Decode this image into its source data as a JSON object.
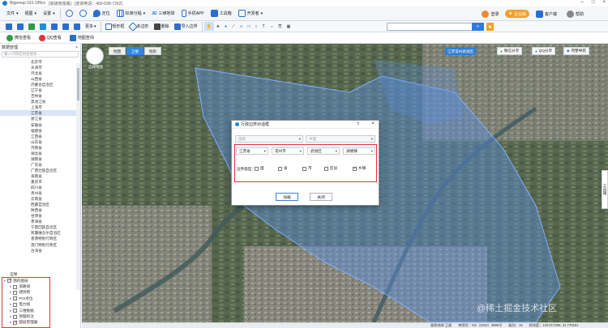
{
  "titlebar": {
    "app": "Bigemap GIS Office",
    "edition": "[高级增强版]",
    "hotline": "[咨询电话：400-028-7262]"
  },
  "menu": {
    "file": "文件",
    "view": "视图",
    "settings": "设置",
    "location": "定位",
    "tile": "标准分幅",
    "three_d": "三维地球",
    "app3d": "3D",
    "phone": "手机APP",
    "toolbox": "工具箱",
    "dev": "开发者",
    "login": "登录",
    "enterprise": "企业版",
    "service": "客户端",
    "help": "帮助"
  },
  "toolbar": {
    "more": "更多",
    "grid": "矩形框",
    "polygon": "多边形",
    "delete": "删除",
    "import": "导入边界",
    "search_placeholder": "",
    "search_icon": "search-icon"
  },
  "bookmarks": {
    "wechat": "微信查看",
    "qq": "QQ查看",
    "map_service": "地图查询"
  },
  "sidebar": {
    "title": "数据管理",
    "search_placeholder": "输入行政区划名搜索...",
    "provinces": [
      "北京市",
      "天津市",
      "河北省",
      "山西省",
      "内蒙古自治区",
      "辽宁省",
      "吉林省",
      "黑龙江省",
      "上海市",
      "江苏省",
      "浙江省",
      "安徽省",
      "福建省",
      "江西省",
      "山东省",
      "河南省",
      "湖北省",
      "湖南省",
      "广东省",
      "广西壮族自治区",
      "海南省",
      "重庆市",
      "四川省",
      "贵州省",
      "云南省",
      "西藏自治区",
      "陕西省",
      "甘肃省",
      "青海省",
      "宁夏回族自治区",
      "新疆维吾尔自治区",
      "香港特别行政区",
      "澳门特别行政区",
      "台湾省"
    ],
    "selected_index": 9,
    "global_label": "全球",
    "layers": [
      {
        "label": "我的图层",
        "checked": true
      },
      {
        "label": "道路线",
        "checked": false
      },
      {
        "label": "建筑物",
        "checked": false
      },
      {
        "label": "POI点位",
        "checked": false
      },
      {
        "label": "电力线",
        "checked": false
      },
      {
        "label": "三维数据",
        "checked": false
      },
      {
        "label": "地理标注",
        "checked": false
      },
      {
        "label": "图层管理器",
        "checked": true
      }
    ]
  },
  "map": {
    "logo_label": "选择地图",
    "tabs": [
      "地图",
      "卫星",
      "地形"
    ],
    "active_tab": 1,
    "admin_chip": "江苏常州武进区",
    "right_buttons": [
      "微信分享",
      "QQ分享",
      "完整导航"
    ],
    "side_tool": "工具箱",
    "watermark": "@稀土掘金技术社区"
  },
  "status": {
    "source": "星图地球 卫星",
    "review": "审图号：GS（2022）3995号",
    "level": "级别：15",
    "coords": "经纬度：120.017296, 31.778151"
  },
  "dialog": {
    "title": "行政边界对话框",
    "help": "?",
    "close": "×",
    "country": "国家",
    "region": "中国",
    "province": "江苏省",
    "city": "常州市",
    "district": "武进区",
    "town": "湖塘镇",
    "boundary_label": "边界类型：",
    "options": [
      {
        "label": "国",
        "checked": false
      },
      {
        "label": "省",
        "checked": false
      },
      {
        "label": "市",
        "checked": false
      },
      {
        "label": "区县",
        "checked": false
      },
      {
        "label": "乡镇",
        "checked": true
      }
    ],
    "ok": "加载",
    "cancel": "关闭"
  },
  "colors": {
    "accent": "#2f7be0",
    "highlight_red": "#e0353a",
    "overlay_blue": "#5b8fe0"
  }
}
